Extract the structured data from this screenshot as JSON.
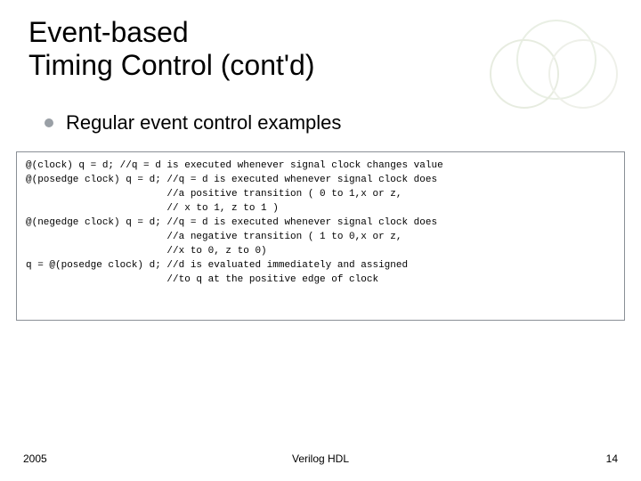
{
  "title_line1": "Event-based",
  "title_line2": "Timing Control (cont'd)",
  "bullet": "Regular event control examples",
  "code_lines": [
    "@(clock) q = d; //q = d is executed whenever signal clock changes value",
    "@(posedge clock) q = d; //q = d is executed whenever signal clock does",
    "                        //a positive transition ( 0 to 1,x or z,",
    "                        // x to 1, z to 1 )",
    "@(negedge clock) q = d; //q = d is executed whenever signal clock does",
    "                        //a negative transition ( 1 to 0,x or z,",
    "                        //x to 0, z to 0)",
    "q = @(posedge clock) d; //d is evaluated immediately and assigned",
    "                        //to q at the positive edge of clock"
  ],
  "footer": {
    "year": "2005",
    "center": "Verilog HDL",
    "page": "14"
  }
}
